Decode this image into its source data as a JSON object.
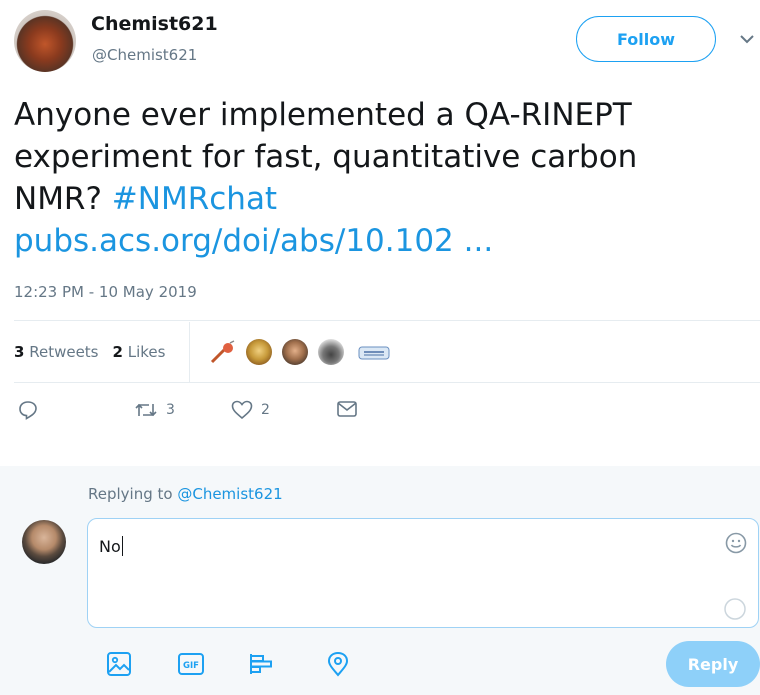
{
  "author": {
    "display_name": "Chemist621",
    "handle": "@Chemist621"
  },
  "follow_label": "Follow",
  "tweet": {
    "text_line1": "Anyone ever implemented a QA-RINEPT",
    "text_line2": "experiment for fast, quantitative carbon",
    "text_line3": "NMR? ",
    "hashtag": "#NMRchat",
    "link": "pubs.acs.org/doi/abs/10.102 ..."
  },
  "timestamp": "12:23 PM - 10 May 2019",
  "stats": {
    "retweets_count": "3",
    "retweets_label": "Retweets",
    "likes_count": "2",
    "likes_label": "Likes"
  },
  "actions": {
    "retweet_count": "3",
    "like_count": "2"
  },
  "reply": {
    "replying_prefix": "Replying to ",
    "replying_handle": "@Chemist621",
    "composer_text": "No",
    "reply_label": "Reply"
  },
  "icons": [
    "caret-down-icon",
    "reply-icon",
    "retweet-icon",
    "like-icon",
    "dm-icon",
    "emoji-icon",
    "image-icon",
    "gif-icon",
    "poll-icon",
    "location-icon"
  ],
  "colors": {
    "accent": "#1da1f2",
    "link": "#1b95e0",
    "muted": "#657786",
    "reply_button_disabled": "#8ed0f9"
  }
}
